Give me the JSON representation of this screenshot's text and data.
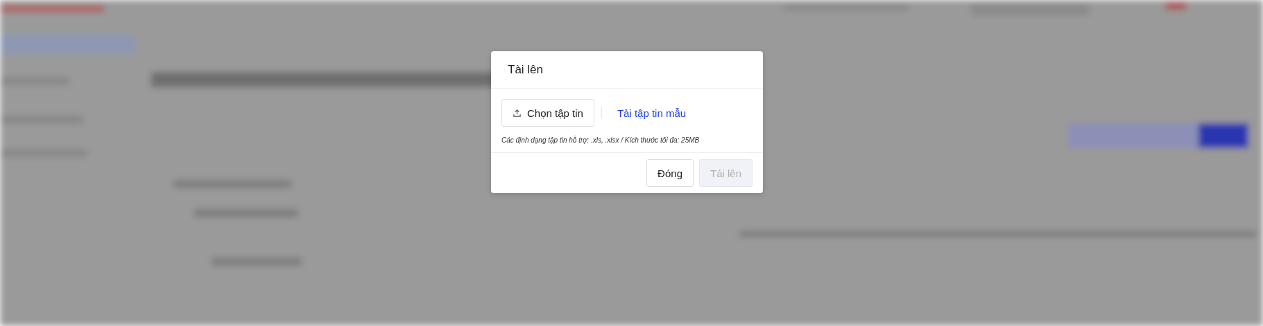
{
  "dialog": {
    "title": "Tài lên",
    "choose_button": {
      "label": "Chọn tập tin"
    },
    "template_link": {
      "label": "Tải tập tin mẫu"
    },
    "hint": "Các định dạng tập tin hỗ trợ: .xls, .xlsx / Kích thước tối đa: 25MB",
    "buttons": [
      {
        "label": "Đóng",
        "kind": "secondary",
        "disabled": false
      },
      {
        "label": "Tải lên",
        "kind": "primary",
        "disabled": true
      }
    ]
  }
}
